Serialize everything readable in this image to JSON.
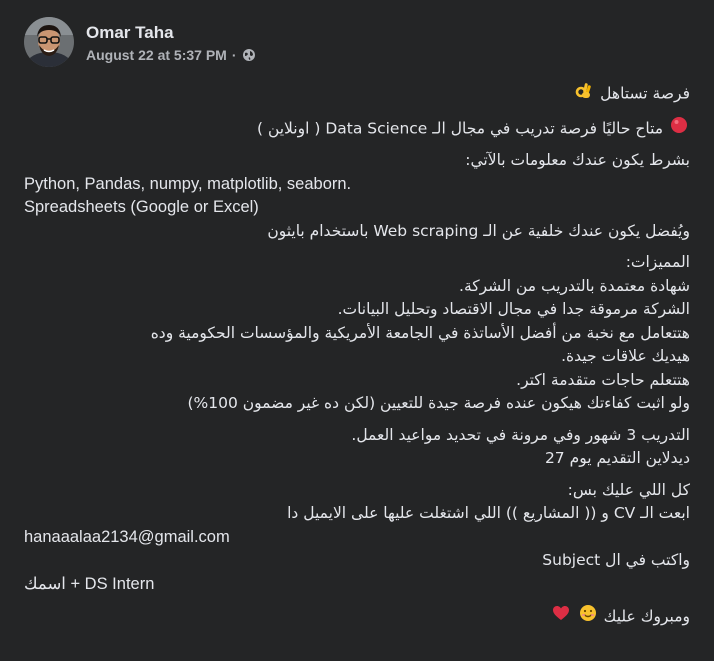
{
  "post": {
    "author": "Omar Taha",
    "timestamp": "August 22 at 5:37 PM",
    "separator": "·",
    "privacy_icon": "globe-icon",
    "avatar_icon": "profile-photo",
    "emojis": {
      "ok_hand": "ok-hand-emoji",
      "red_circle": "red-circle-emoji",
      "smiley": "smiling-face-emoji",
      "heart": "red-heart-emoji"
    },
    "lines": {
      "l1": "فرصة تستاهل",
      "l2": "متاح حاليًا فرصة تدريب في مجال الـ Data Science ( اونلاين )",
      "l3": "بشرط يكون عندك معلومات بالآتي:",
      "l4": "Python, Pandas, numpy, matplotlib, seaborn.",
      "l5": "Spreadsheets (Google or Excel)",
      "l6": "ويُفضل يكون عندك خلفية عن الـ Web scraping باستخدام بايثون",
      "l7": "المميزات:",
      "l8": "شهادة معتمدة بالتدريب من الشركة.",
      "l9": "الشركة مرموقة جدا في مجال الاقتصاد وتحليل البيانات.",
      "l10": "هتتعامل مع نخبة من أفضل الأساتذة في الجامعة الأمريكية والمؤسسات الحكومية وده",
      "l11": "هيديك علاقات جيدة.",
      "l12": "هتتعلم حاجات متقدمة اكتر.",
      "l13": "ولو اثبت كفاءتك هيكون عنده فرصة جيدة للتعيين (لكن ده غير مضمون 100%)",
      "l14": "التدريب 3 شهور وفي مرونة في تحديد مواعيد العمل.",
      "l15": "ديدلاين التقديم يوم 27",
      "l16": "كل اللي عليك بس:",
      "l17": "ابعت الـ CV و (( المشاريع )) اللي اشتغلت عليها على الايميل دا",
      "l18": "hanaaalaa2134@gmail.com",
      "l19": "واكتب في ال Subject",
      "l20": "DS Intern + اسمك",
      "l21": "ومبروك عليك"
    }
  }
}
